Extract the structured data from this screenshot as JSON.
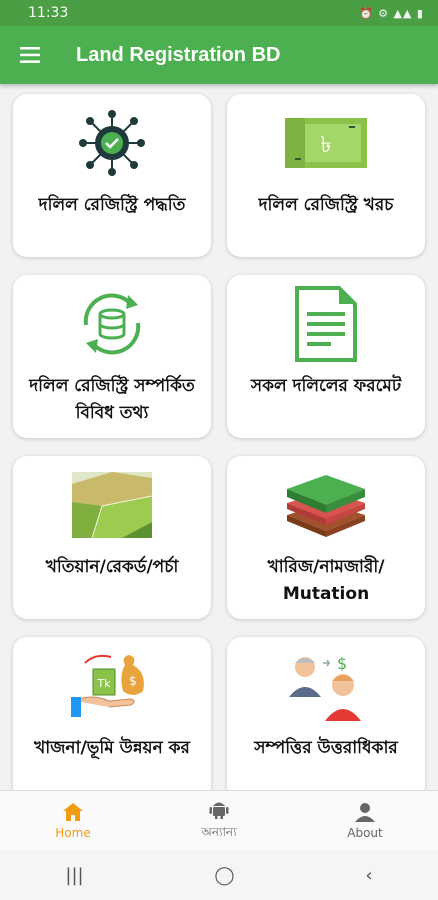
{
  "status": {
    "time": "11:33",
    "right": "⏰ ⚙ ▲▲ ▮"
  },
  "appbar": {
    "title": "Land Registration BD"
  },
  "cards": [
    {
      "label": "দলিল রেজিস্ট্রি পদ্ধতি",
      "icon": "gear-network-icon"
    },
    {
      "label": "দলিল রেজিস্ট্রি খরচ",
      "icon": "money-note-icon"
    },
    {
      "label": "দলিল রেজিস্ট্রি সম্পর্কিত বিবিধ তথ্য",
      "icon": "database-sync-icon"
    },
    {
      "label": "সকল দলিলের ফরমেট",
      "icon": "document-icon"
    },
    {
      "label": "খতিয়ান/রেকর্ড/পর্চা",
      "icon": "field-map-icon"
    },
    {
      "label": "খারিজ/নামজারী/ Mutation",
      "icon": "land-layers-icon"
    },
    {
      "label": "খাজনা/ভূমি উন্নয়ন কর",
      "icon": "money-bag-hand-icon"
    },
    {
      "label": "সম্পত্তির উত্তরাধিকার",
      "icon": "inheritance-people-icon"
    }
  ],
  "nav": {
    "home": "Home",
    "other": "অন্যান্য",
    "about": "About"
  },
  "colors": {
    "primary": "#4caf50",
    "accent": "#f39c12"
  }
}
